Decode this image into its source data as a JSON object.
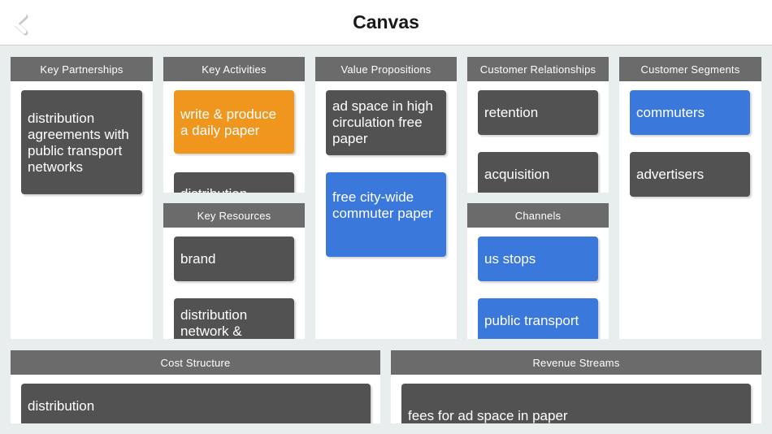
{
  "header": {
    "title": "Canvas",
    "back_icon": "chevron-left-icon"
  },
  "colors": {
    "header_bar": "#6b6b6b",
    "card_dark": "#525252",
    "card_blue": "#3b78dc",
    "card_orange": "#f0961f",
    "background": "#e8eded"
  },
  "sections": {
    "key_partnerships": {
      "title": "Key Partnerships",
      "cards": [
        {
          "text": "distribution agreements with public transport networks",
          "color": "dark"
        }
      ]
    },
    "key_activities": {
      "title": "Key Activities",
      "cards": [
        {
          "text": "write & produce a daily paper",
          "color": "orange"
        },
        {
          "text": "distribution",
          "color": "dark"
        }
      ]
    },
    "key_resources": {
      "title": "Key Resources",
      "cards": [
        {
          "text": "brand",
          "color": "dark"
        },
        {
          "text": "distribution network &",
          "color": "dark"
        }
      ]
    },
    "value_propositions": {
      "title": "Value Propositions",
      "cards": [
        {
          "text": "ad space in high circulation free paper",
          "color": "dark"
        },
        {
          "text": "free city-wide commuter paper",
          "color": "blue"
        }
      ]
    },
    "customer_relationships": {
      "title": "Customer Relationships",
      "cards": [
        {
          "text": "retention",
          "color": "dark"
        },
        {
          "text": "acquisition",
          "color": "dark"
        }
      ]
    },
    "channels": {
      "title": "Channels",
      "cards": [
        {
          "text": "us stops",
          "color": "blue"
        },
        {
          "text": "public transport",
          "color": "blue"
        }
      ]
    },
    "customer_segments": {
      "title": "Customer Segments",
      "cards": [
        {
          "text": "commuters",
          "color": "blue"
        },
        {
          "text": "advertisers",
          "color": "dark"
        }
      ]
    },
    "cost_structure": {
      "title": "Cost Structure",
      "cards": [
        {
          "text": "distribution",
          "color": "dark"
        }
      ]
    },
    "revenue_streams": {
      "title": "Revenue Streams",
      "cards": [
        {
          "text": "fees for ad space in paper",
          "color": "dark"
        }
      ]
    }
  }
}
